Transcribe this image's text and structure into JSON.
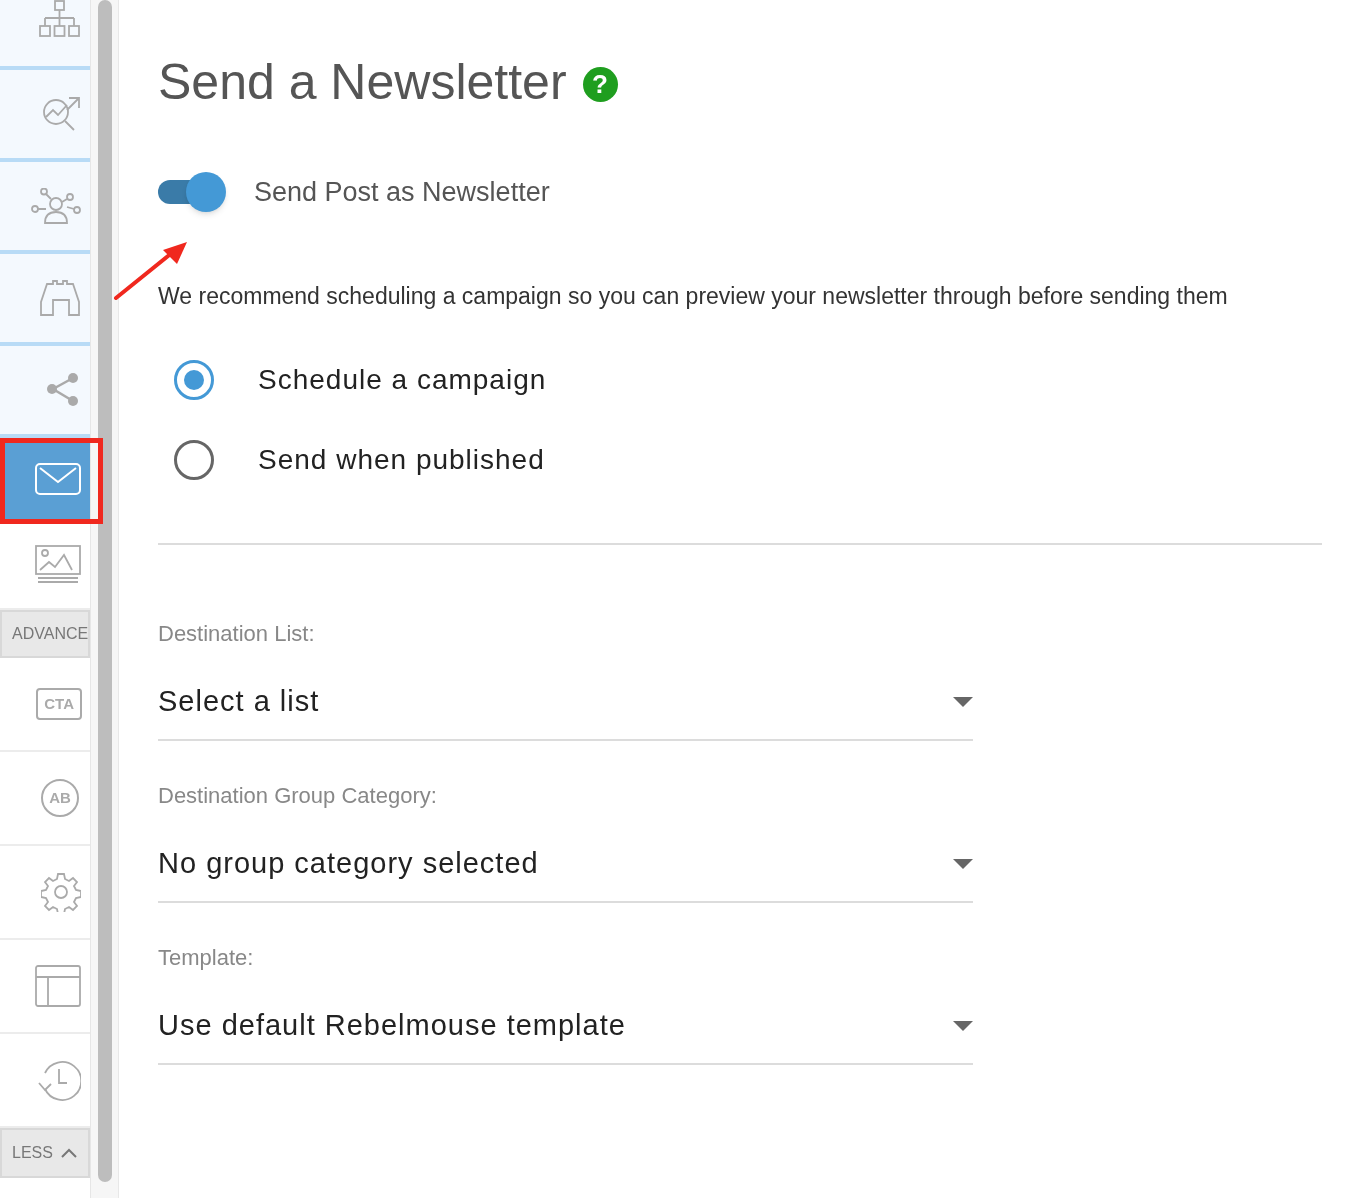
{
  "sidebar": {
    "items": [
      {
        "kind": "icon",
        "selected": false
      },
      {
        "kind": "icon",
        "selected": false
      },
      {
        "kind": "icon",
        "selected": false
      },
      {
        "kind": "icon",
        "selected": false
      },
      {
        "kind": "icon",
        "selected": false
      },
      {
        "kind": "icon",
        "selected": true
      },
      {
        "kind": "icon",
        "selected": false
      },
      {
        "kind": "header",
        "label": "ADVANCE"
      },
      {
        "kind": "icon",
        "label": "CTA",
        "selected": false
      },
      {
        "kind": "icon",
        "label": "AB",
        "selected": false
      },
      {
        "kind": "icon",
        "selected": false
      },
      {
        "kind": "icon",
        "selected": false
      },
      {
        "kind": "icon",
        "selected": false
      },
      {
        "kind": "header",
        "label": "LESS"
      }
    ]
  },
  "title": "Send a Newsletter",
  "help": "?",
  "toggle": {
    "label": "Send Post as Newsletter",
    "on": true
  },
  "note": "We recommend scheduling a campaign so you can preview your newsletter through before sending them",
  "radios": [
    {
      "label": "Schedule a campaign",
      "selected": true
    },
    {
      "label": "Send when published",
      "selected": false
    }
  ],
  "fields": [
    {
      "label": "Destination List:",
      "value": "Select a list"
    },
    {
      "label": "Destination Group Category:",
      "value": "No group category selected"
    },
    {
      "label": "Template:",
      "value": "Use default Rebelmouse template"
    }
  ]
}
